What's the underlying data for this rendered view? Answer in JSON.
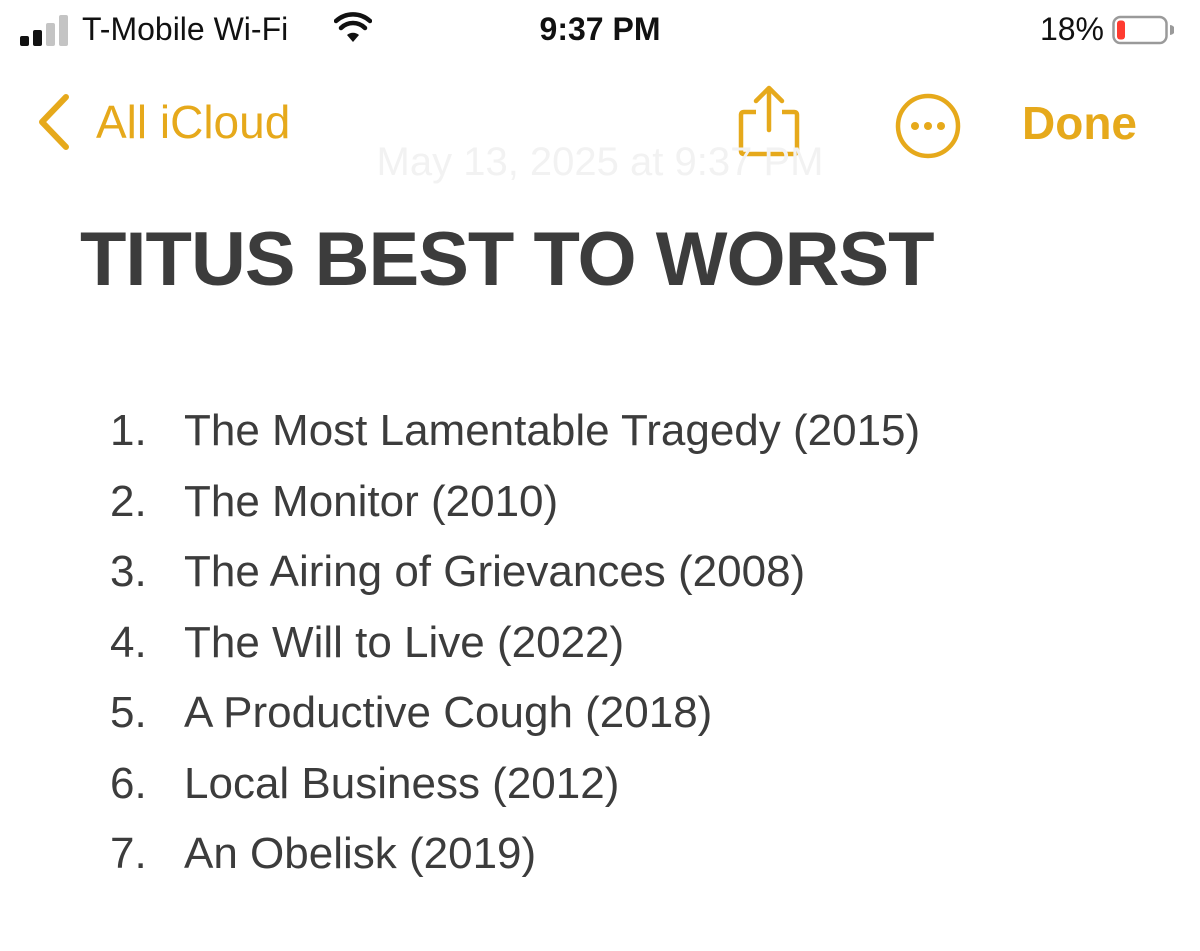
{
  "status_bar": {
    "carrier": "T-Mobile Wi-Fi",
    "time": "9:37 PM",
    "battery_percent": "18%",
    "signal_bars_filled": 2,
    "signal_bars_total": 4,
    "battery_level": 0.18,
    "battery_color": "#ff3b30"
  },
  "nav": {
    "back_label": "All iCloud",
    "done_label": "Done",
    "accent_color": "#e6a91b",
    "icons": {
      "back": "chevron-left-icon",
      "share": "share-icon",
      "more": "ellipsis-circle-icon"
    }
  },
  "note": {
    "timestamp": "May 13, 2025 at 9:37 PM",
    "title": "TITUS BEST TO WORST",
    "items": [
      {
        "number": "1.",
        "text": "The Most Lamentable Tragedy (2015)"
      },
      {
        "number": "2.",
        "text": "The Monitor (2010)"
      },
      {
        "number": "3.",
        "text": "The Airing of Grievances (2008)"
      },
      {
        "number": "4.",
        "text": "The Will to Live (2022)"
      },
      {
        "number": "5.",
        "text": "A Productive Cough (2018)"
      },
      {
        "number": "6.",
        "text": "Local Business (2012)"
      },
      {
        "number": "7.",
        "text": "An Obelisk (2019)"
      }
    ]
  }
}
